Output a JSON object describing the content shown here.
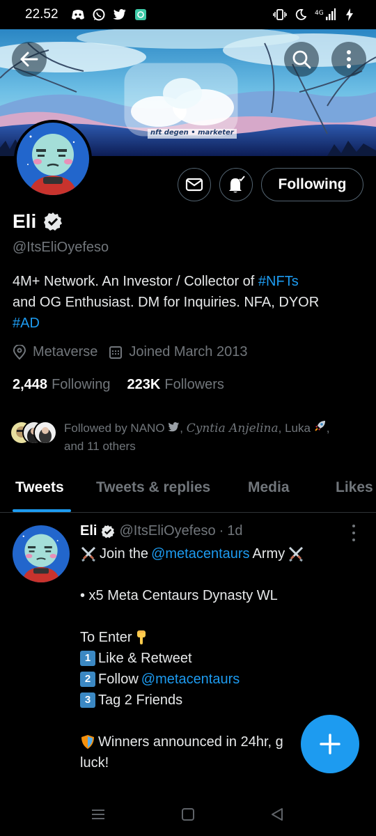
{
  "status_bar": {
    "time": "22.52",
    "network": "4G"
  },
  "profile": {
    "name": "Eli",
    "handle": "@ItsEliOyefeso",
    "banner_text": "nft degen • marketer",
    "bio": {
      "line1_text": "4M+ Network. An Investor / Collector of ",
      "line1_link": "#NFTs",
      "line2": "and OG Enthusiast. DM for Inquiries. NFA, DYOR",
      "line3_link": "#AD"
    },
    "location": "Metaverse",
    "joined": "Joined March 2013",
    "following_count": "2,448",
    "following_label": "Following",
    "followers_count": "223K",
    "followers_label": "Followers",
    "followed_by": {
      "prefix": "Followed by NANO",
      "cursive_name": "Cyntia Anjelina",
      "suffix": ", Luka",
      "line2": "and 11 others"
    }
  },
  "buttons": {
    "following": "Following"
  },
  "tabs": [
    {
      "label": "Tweets",
      "active": true
    },
    {
      "label": "Tweets & replies",
      "active": false
    },
    {
      "label": "Media",
      "active": false
    },
    {
      "label": "Likes",
      "active": false
    }
  ],
  "tweet": {
    "name": "Eli",
    "handle": "@ItsEliOyefeso",
    "time": "1d",
    "line1_pre": "Join the",
    "line1_link": "@metacentaurs",
    "line1_post": "Army",
    "line2": "• x5 Meta Centaurs Dynasty WL",
    "line3": "To Enter",
    "step1_num": "1",
    "step1": "Like & Retweet",
    "step2_num": "2",
    "step2_pre": "Follow",
    "step2_link": "@metacentaurs",
    "step3_num": "3",
    "step3": "Tag 2 Friends",
    "line4": "Winners announced in 24hr, g",
    "line5": "luck!"
  },
  "colors": {
    "accent": "#1d9bf0",
    "secondary_text": "#71767b",
    "background": "#000000"
  }
}
